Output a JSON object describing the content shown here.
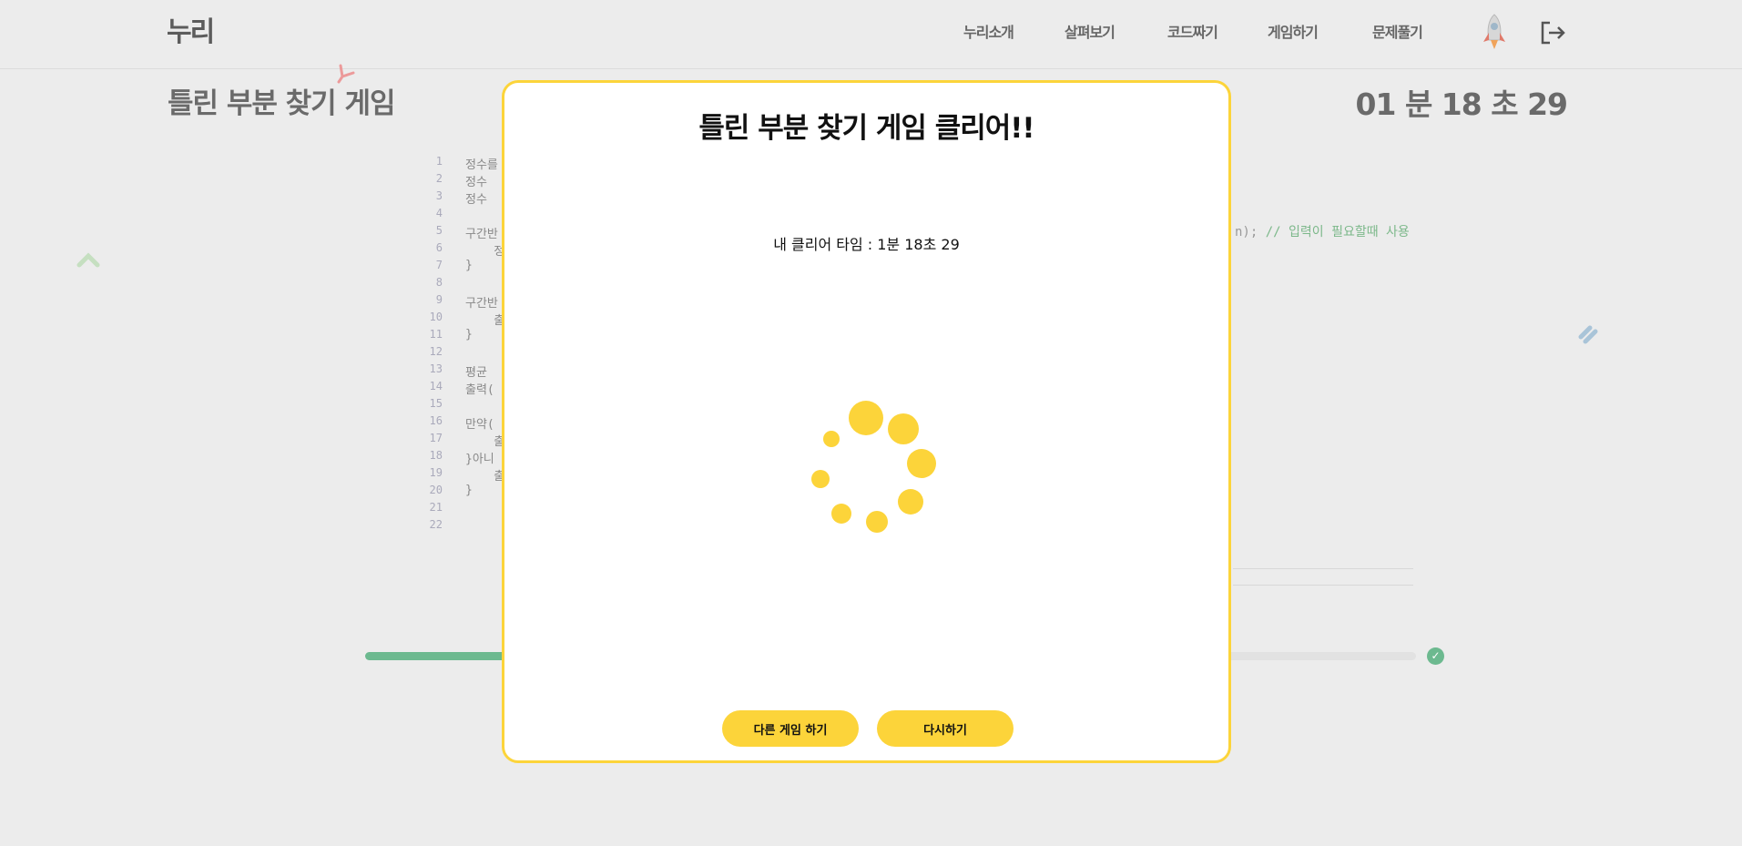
{
  "header": {
    "logo": "누리",
    "nav": [
      "누리소개",
      "살펴보기",
      "코드짜기",
      "게임하기",
      "문제풀기"
    ],
    "avatar_icon": "rocket-icon",
    "logout_icon": "logout-icon"
  },
  "page": {
    "title": "틀린 부분 찾기 게임",
    "timer": "01 분 18 초 29"
  },
  "code": {
    "line_numbers": [
      "1",
      "2",
      "3",
      "4",
      "5",
      "6",
      "7",
      "8",
      "9",
      "10",
      "11",
      "12",
      "13",
      "14",
      "15",
      "16",
      "17",
      "18",
      "19",
      "20",
      "21",
      "22"
    ],
    "lines": [
      "정수를",
      "정수 ",
      "정수 ",
      "",
      "구간반",
      "    정",
      "}",
      "",
      "구간반",
      "    출",
      "}",
      "",
      "평균 ",
      "출력(",
      "",
      "만약(",
      "    출",
      "}아니",
      "    출",
      "}",
      "",
      ""
    ],
    "right_fragment_code": "n); ",
    "right_fragment_comment": "// 입력이 필요할때 사용"
  },
  "progress": {
    "fraction": 0.2,
    "check_icon": "check-icon"
  },
  "modal": {
    "title": "틀린 부분 찾기 게임 클리어!!",
    "clear_time": "내 클리어 타임 : 1분 18초 29",
    "spinner_icon": "loading-spinner-icon",
    "other_game_label": "다른 게임 하기",
    "retry_label": "다시하기"
  },
  "colors": {
    "accent_yellow": "#fcd43a",
    "progress_green": "#6cb98f",
    "background": "#ececec"
  }
}
